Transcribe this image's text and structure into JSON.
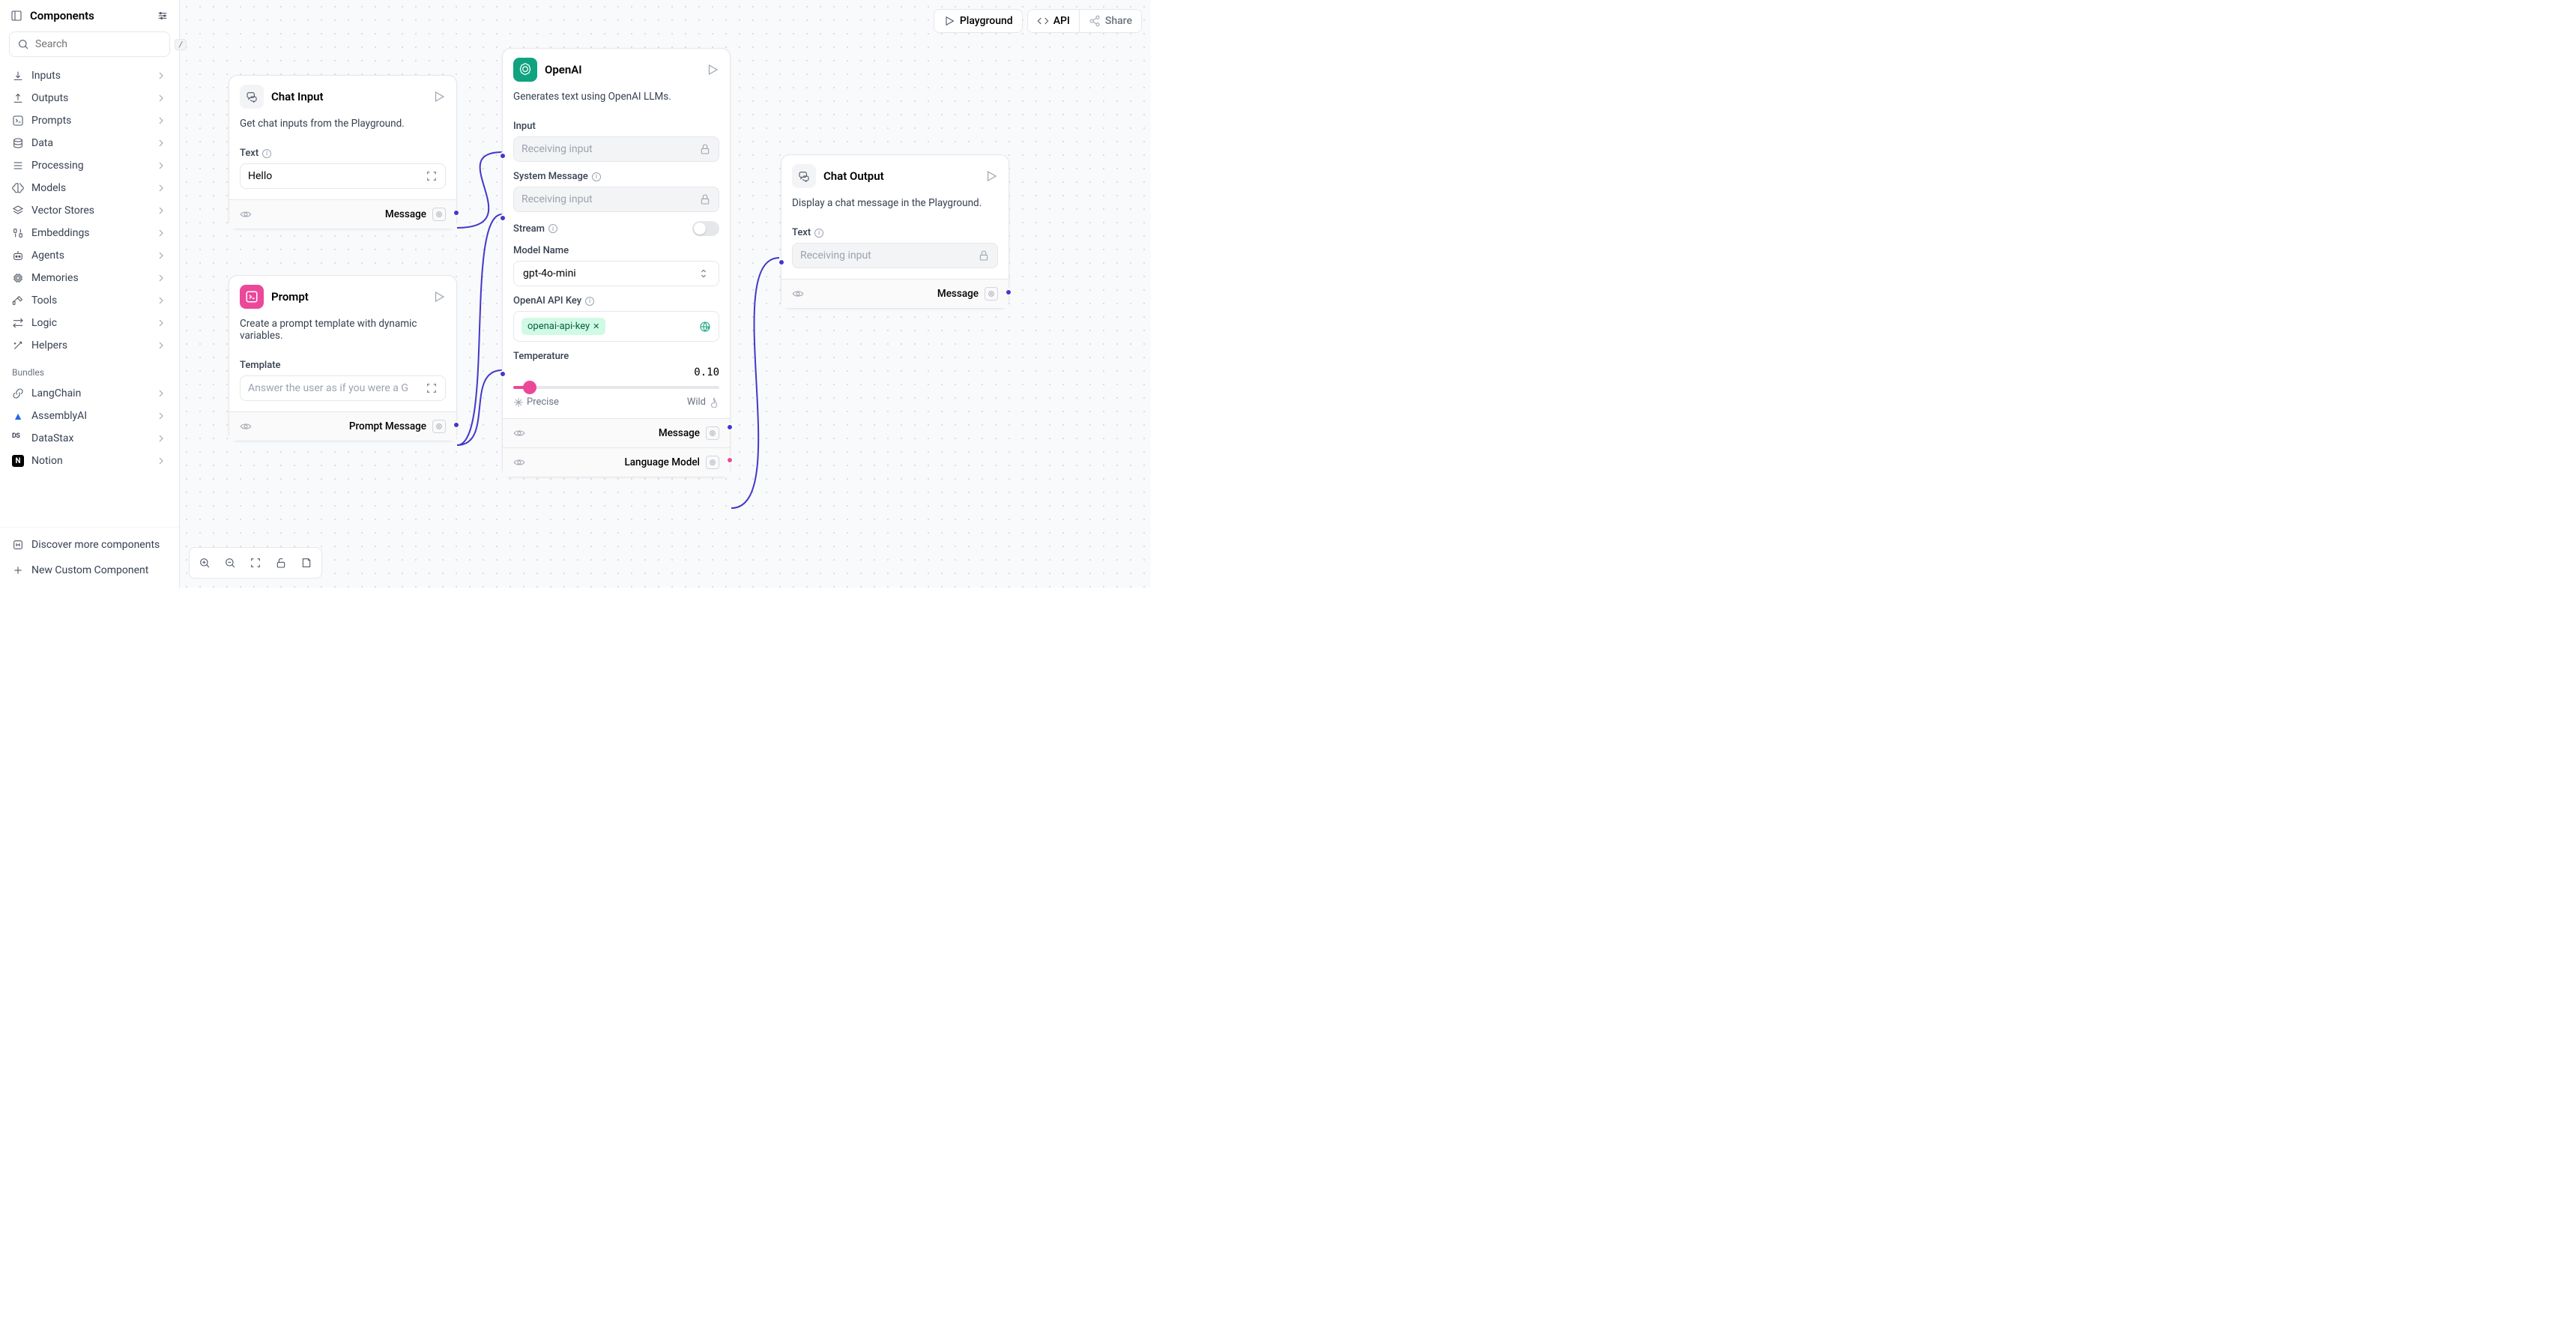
{
  "sidebar": {
    "title": "Components",
    "search_placeholder": "Search",
    "search_kbd": "/",
    "categories": [
      {
        "label": "Inputs",
        "icon": "download"
      },
      {
        "label": "Outputs",
        "icon": "upload"
      },
      {
        "label": "Prompts",
        "icon": "prompt"
      },
      {
        "label": "Data",
        "icon": "database"
      },
      {
        "label": "Processing",
        "icon": "list"
      },
      {
        "label": "Models",
        "icon": "brain"
      },
      {
        "label": "Vector Stores",
        "icon": "layers"
      },
      {
        "label": "Embeddings",
        "icon": "binary"
      },
      {
        "label": "Agents",
        "icon": "bot"
      },
      {
        "label": "Memories",
        "icon": "chip"
      },
      {
        "label": "Tools",
        "icon": "hammer"
      },
      {
        "label": "Logic",
        "icon": "swap"
      },
      {
        "label": "Helpers",
        "icon": "wand"
      }
    ],
    "bundles_header": "Bundles",
    "bundles": [
      {
        "label": "LangChain",
        "icon": "link"
      },
      {
        "label": "AssemblyAI",
        "icon": "assembly"
      },
      {
        "label": "DataStax",
        "icon": "datastax"
      },
      {
        "label": "Notion",
        "icon": "notion"
      }
    ],
    "discover": "Discover more components",
    "new_custom": "New Custom Component"
  },
  "topbar": {
    "playground": "Playground",
    "api": "API",
    "share": "Share"
  },
  "nodes": {
    "chat_input": {
      "title": "Chat Input",
      "desc": "Get chat inputs from the Playground.",
      "text_label": "Text",
      "text_value": "Hello",
      "output": "Message"
    },
    "prompt": {
      "title": "Prompt",
      "desc": "Create a prompt template with dynamic variables.",
      "template_label": "Template",
      "template_value": "Answer the user as if you were a G",
      "output": "Prompt Message"
    },
    "openai": {
      "title": "OpenAI",
      "desc": "Generates text using OpenAI LLMs.",
      "input_label": "Input",
      "input_placeholder": "Receiving input",
      "sysmsg_label": "System Message",
      "sysmsg_placeholder": "Receiving input",
      "stream_label": "Stream",
      "model_label": "Model Name",
      "model_value": "gpt-4o-mini",
      "apikey_label": "OpenAI API Key",
      "apikey_tag": "openai-api-key",
      "temp_label": "Temperature",
      "temp_value": "0.10",
      "temp_precise": "Precise",
      "temp_wild": "Wild",
      "output_msg": "Message",
      "output_lm": "Language Model"
    },
    "chat_output": {
      "title": "Chat Output",
      "desc": "Display a chat message in the Playground.",
      "text_label": "Text",
      "text_placeholder": "Receiving input",
      "output": "Message"
    }
  }
}
